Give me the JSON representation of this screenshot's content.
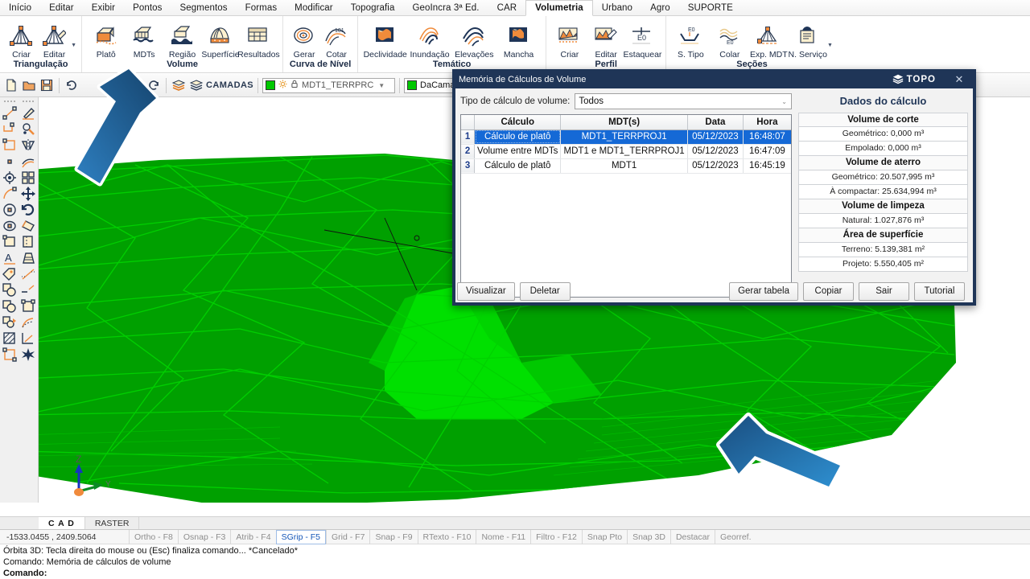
{
  "menubar": {
    "items": [
      {
        "label": "Início",
        "active": false
      },
      {
        "label": "Editar",
        "active": false
      },
      {
        "label": "Exibir",
        "active": false
      },
      {
        "label": "Pontos",
        "active": false
      },
      {
        "label": "Segmentos",
        "active": false
      },
      {
        "label": "Formas",
        "active": false
      },
      {
        "label": "Modificar",
        "active": false
      },
      {
        "label": "Topografia",
        "active": false
      },
      {
        "label": "GeoIncra 3ª Ed.",
        "active": false
      },
      {
        "label": "CAR",
        "active": false
      },
      {
        "label": "Volumetria",
        "active": true
      },
      {
        "label": "Urbano",
        "active": false
      },
      {
        "label": "Agro",
        "active": false
      },
      {
        "label": "SUPORTE",
        "active": false
      }
    ]
  },
  "ribbon": {
    "groups": [
      {
        "title": "Triangulação",
        "has_caret": true,
        "buttons": [
          {
            "label": "Criar",
            "icon": "triangulation-create-icon"
          },
          {
            "label": "Editar",
            "icon": "triangulation-edit-icon"
          }
        ]
      },
      {
        "title": "Volume",
        "has_caret": false,
        "buttons": [
          {
            "label": "Platô",
            "icon": "plateau-icon"
          },
          {
            "label": "MDTs",
            "icon": "mdts-icon"
          },
          {
            "label": "Região",
            "icon": "region-icon"
          },
          {
            "label": "Superfície",
            "icon": "surface-icon"
          },
          {
            "label": "Resultados",
            "icon": "results-table-icon"
          }
        ]
      },
      {
        "title": "Curva de Nível",
        "has_caret": false,
        "buttons": [
          {
            "label": "Gerar",
            "icon": "contour-generate-icon"
          },
          {
            "label": "Cotar",
            "icon": "contour-label-icon"
          }
        ]
      },
      {
        "title": "Temático",
        "has_caret": false,
        "buttons": [
          {
            "label": "Declividade",
            "icon": "slope-map-icon"
          },
          {
            "label": "Inundação",
            "icon": "flood-map-icon"
          },
          {
            "label": "Elevações",
            "icon": "elevation-map-icon"
          },
          {
            "label": "Mancha",
            "icon": "patch-map-icon"
          }
        ]
      },
      {
        "title": "Perfil",
        "has_caret": false,
        "buttons": [
          {
            "label": "Criar",
            "icon": "profile-create-icon"
          },
          {
            "label": "Editar",
            "icon": "profile-edit-icon"
          },
          {
            "label": "Estaquear",
            "icon": "stake-icon"
          }
        ]
      },
      {
        "title": "Seções",
        "has_caret": true,
        "buttons": [
          {
            "label": "S. Tipo",
            "icon": "section-type-icon"
          },
          {
            "label": "Colar",
            "icon": "paste-section-icon"
          },
          {
            "label": "Exp. MDT",
            "icon": "export-mdt-icon"
          },
          {
            "label": "N. Serviço",
            "icon": "service-note-icon"
          }
        ]
      }
    ]
  },
  "toolbar2": {
    "icons": [
      "new-file-icon",
      "open-folder-icon",
      "save-disk-icon",
      "undo-icon",
      "redo-icon"
    ],
    "layers_icon_1": "layers-stack-orange-icon",
    "layers_icon_2": "layers-stack-icon",
    "layers_label": "CAMADAS",
    "layer_combo": {
      "color": "#00c800",
      "sun_icon": "sun-visibility-icon",
      "lock_icon": "lock-icon",
      "value": "MDT1_TERRPRC",
      "dropdown_icon": "chevron-down-icon"
    },
    "layer_color_combo": {
      "color": "#00c800",
      "value": "DaCamada",
      "dropdown_icon": "chevron-down-icon"
    }
  },
  "left_palette": {
    "col1": [
      "line-icon",
      "polyline-icon",
      "rectangle-icon",
      "point-icon",
      "insert-point-icon",
      "arc-icon",
      "circle-icon",
      "ellipse-icon",
      "polygon-icon",
      "text-icon",
      "tag-icon",
      "overlap-circles-icon",
      "union-shapes-icon",
      "rotate-shape-icon",
      "hatch-icon",
      "crop-icon"
    ],
    "col2": [
      "brush-icon",
      "magic-wand-icon",
      "mirror-icon",
      "offset-icon",
      "grid-split-icon",
      "move-icon",
      "rotate-icon",
      "scale-icon",
      "trim-icon",
      "extend-icon",
      "divide-line-icon",
      "break-line-icon",
      "fillet-icon",
      "curve-icon",
      "chamfer-icon",
      "explode-icon"
    ]
  },
  "viewport": {
    "axis": {
      "z_label": "Z",
      "y_label": "Y"
    },
    "terrain_color_dark": "#00a000",
    "terrain_color_mid": "#00b400",
    "terrain_color_bright": "#00e000",
    "wire_color": "#00d000",
    "background": "#ffffff",
    "annotation_arrows": [
      {
        "name": "arrow-pointing-to-volumetria-tab",
        "direction": "up-left"
      },
      {
        "name": "arrow-pointing-to-terrain",
        "direction": "up-left"
      }
    ]
  },
  "dialog": {
    "title": "Memória de Cálculos de Volume",
    "brand": "TOPO",
    "brand_icon": "topo-layers-logo-icon",
    "close_icon": "close-icon",
    "filter": {
      "label": "Tipo de cálculo de volume:",
      "value": "Todos",
      "dropdown_icon": "chevron-down-icon"
    },
    "grid": {
      "columns": [
        "",
        "Cálculo",
        "MDT(s)",
        "Data",
        "Hora"
      ],
      "rows": [
        {
          "n": "1",
          "calculo": "Cálculo de platô",
          "mdts": "MDT1_TERRPROJ1",
          "data": "05/12/2023",
          "hora": "16:48:07",
          "selected": true
        },
        {
          "n": "2",
          "calculo": "Volume entre MDTs",
          "mdts": "MDT1 e MDT1_TERRPROJ1",
          "data": "05/12/2023",
          "hora": "16:47:09",
          "selected": false
        },
        {
          "n": "3",
          "calculo": "Cálculo de platô",
          "mdts": "MDT1",
          "data": "05/12/2023",
          "hora": "16:45:19",
          "selected": false
        }
      ]
    },
    "results": {
      "title": "Dados do cálculo",
      "sections": [
        {
          "title": "Volume de corte",
          "rows": [
            "Geométrico: 0,000 m³",
            "Empolado: 0,000 m³"
          ]
        },
        {
          "title": "Volume de aterro",
          "rows": [
            "Geométrico: 20.507,995 m³",
            "À compactar: 25.634,994 m³"
          ]
        },
        {
          "title": "Volume de limpeza",
          "rows": [
            "Natural: 1.027,876 m³"
          ]
        },
        {
          "title": "Área de superfície",
          "rows": [
            "Terreno: 5.139,381 m²",
            "Projeto: 5.550,405 m²"
          ]
        }
      ]
    },
    "buttons_left": [
      {
        "label": "Visualizar",
        "name": "visualizar-button"
      },
      {
        "label": "Deletar",
        "name": "deletar-button"
      }
    ],
    "buttons_right": [
      {
        "label": "Gerar tabela",
        "name": "gerar-tabela-button"
      },
      {
        "label": "Copiar",
        "name": "copiar-button"
      },
      {
        "label": "Sair",
        "name": "sair-button"
      },
      {
        "label": "Tutorial",
        "name": "tutorial-button"
      }
    ]
  },
  "doctabs": [
    {
      "label": "C A D",
      "active": true
    },
    {
      "label": "RASTER",
      "active": false
    }
  ],
  "statusbar": {
    "coords": "-1533.0455 , 2409.5064",
    "toggles": [
      {
        "label": "Ortho - F8",
        "on": false
      },
      {
        "label": "Osnap - F3",
        "on": false
      },
      {
        "label": "Atrib - F4",
        "on": false
      },
      {
        "label": "SGrip - F5",
        "on": true
      },
      {
        "label": "Grid - F7",
        "on": false
      },
      {
        "label": "Snap - F9",
        "on": false
      },
      {
        "label": "RTexto - F10",
        "on": false
      },
      {
        "label": "Nome - F11",
        "on": false
      },
      {
        "label": "Filtro - F12",
        "on": false
      },
      {
        "label": "Snap Pto",
        "on": false
      },
      {
        "label": "Snap 3D",
        "on": false
      },
      {
        "label": "Destacar",
        "on": false
      },
      {
        "label": "Georref.",
        "on": false
      }
    ]
  },
  "command_log": {
    "line1": "Órbita 3D: Tecla direita do mouse ou (Esc) finaliza comando... *Cancelado*",
    "line2": "Comando: Memória de cálculos de volume",
    "line3": "Comando:"
  }
}
